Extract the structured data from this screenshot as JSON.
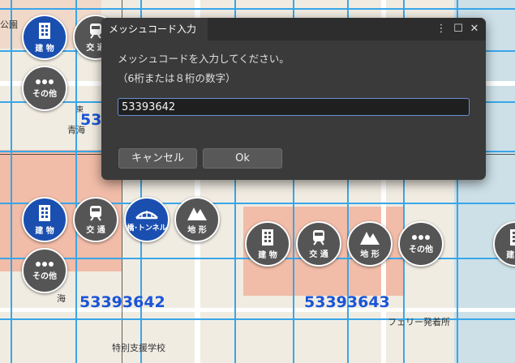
{
  "dialog": {
    "title": "メッシュコード入力",
    "message_line1": "メッシュコードを入力してください。",
    "message_line2": "（6桁または８桁の数字）",
    "input_value": "53393642",
    "cancel_label": "キャンセル",
    "ok_label": "Ok",
    "menu_icon": "⋮",
    "maximize_icon": "☐",
    "close_icon": "✕"
  },
  "map": {
    "mesh_labels": [
      "53393642",
      "53393643",
      "53"
    ],
    "place_labels": [
      "フェリー発着所",
      "特別支援学校",
      "青海",
      "公園",
      "東",
      "海"
    ],
    "category_buttons": [
      {
        "icon": "building-icon",
        "label": "建 物"
      },
      {
        "icon": "train-icon",
        "label": "交 通"
      },
      {
        "icon": "more-icon",
        "label": "その他"
      },
      {
        "icon": "building-icon",
        "label": "建 物"
      },
      {
        "icon": "train-icon",
        "label": "交 通"
      },
      {
        "icon": "bridge-icon",
        "label": "橋･トンネル"
      },
      {
        "icon": "terrain-icon",
        "label": "地 形"
      },
      {
        "icon": "more-icon",
        "label": "その他"
      },
      {
        "icon": "building-icon",
        "label": "建 物"
      },
      {
        "icon": "train-icon",
        "label": "交 通"
      },
      {
        "icon": "terrain-icon",
        "label": "地 形"
      },
      {
        "icon": "more-icon",
        "label": "その他"
      },
      {
        "icon": "building-icon",
        "label": "建 物"
      }
    ]
  }
}
